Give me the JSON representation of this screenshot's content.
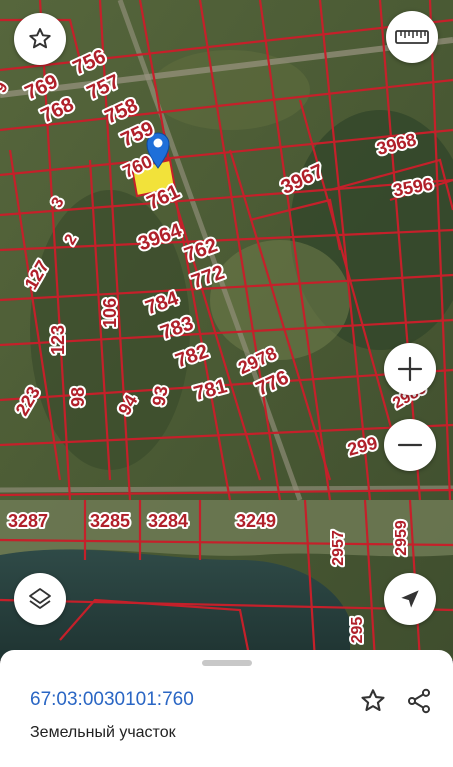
{
  "map": {
    "parcel_labels": [
      "756",
      "757",
      "758",
      "759",
      "760",
      "761",
      "769",
      "768",
      "3968",
      "3967",
      "3596",
      "3964",
      "762",
      "772",
      "784",
      "783",
      "782",
      "781",
      "2978",
      "776",
      "2989",
      "299",
      "3287",
      "3285",
      "3284",
      "3249",
      "2957",
      "2959",
      "295",
      "127",
      "123",
      "106",
      "223",
      "98",
      "94",
      "93",
      "3",
      "2",
      "9"
    ],
    "selected_parcel": "760",
    "colors": {
      "boundary": "#c5202a",
      "selected_fill": "#f2e23a",
      "marker": "#1e6fd9",
      "label_text": "#b0202a"
    }
  },
  "controls": {
    "favorite_icon": "star-outline-icon",
    "ruler_icon": "ruler-icon",
    "layers_icon": "layers-icon",
    "locate_icon": "navigation-arrow-icon",
    "zoom_in": "+",
    "zoom_out": "−"
  },
  "sheet": {
    "cadastral_number": "67:03:0030101:760",
    "object_type": "Земельный участок",
    "icons": {
      "favorite": "star-outline-icon",
      "share": "share-icon"
    }
  }
}
